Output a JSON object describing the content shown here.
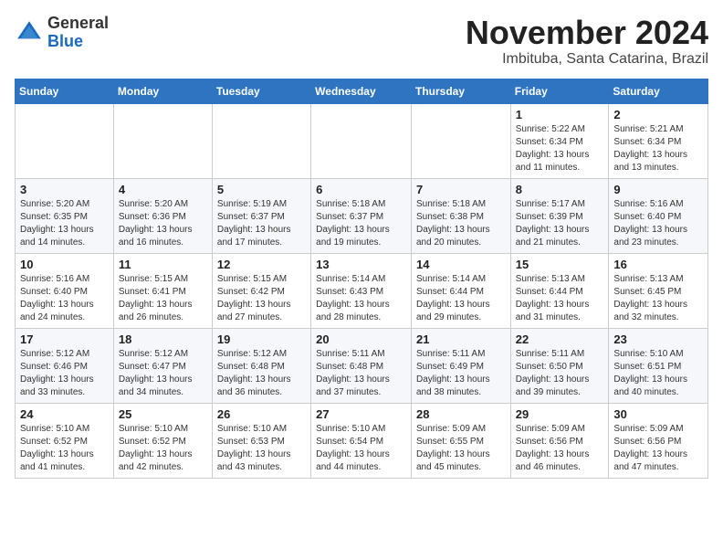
{
  "header": {
    "logo_general": "General",
    "logo_blue": "Blue",
    "month_title": "November 2024",
    "location": "Imbituba, Santa Catarina, Brazil"
  },
  "weekdays": [
    "Sunday",
    "Monday",
    "Tuesday",
    "Wednesday",
    "Thursday",
    "Friday",
    "Saturday"
  ],
  "weeks": [
    [
      {
        "day": "",
        "info": ""
      },
      {
        "day": "",
        "info": ""
      },
      {
        "day": "",
        "info": ""
      },
      {
        "day": "",
        "info": ""
      },
      {
        "day": "",
        "info": ""
      },
      {
        "day": "1",
        "info": "Sunrise: 5:22 AM\nSunset: 6:34 PM\nDaylight: 13 hours and 11 minutes."
      },
      {
        "day": "2",
        "info": "Sunrise: 5:21 AM\nSunset: 6:34 PM\nDaylight: 13 hours and 13 minutes."
      }
    ],
    [
      {
        "day": "3",
        "info": "Sunrise: 5:20 AM\nSunset: 6:35 PM\nDaylight: 13 hours and 14 minutes."
      },
      {
        "day": "4",
        "info": "Sunrise: 5:20 AM\nSunset: 6:36 PM\nDaylight: 13 hours and 16 minutes."
      },
      {
        "day": "5",
        "info": "Sunrise: 5:19 AM\nSunset: 6:37 PM\nDaylight: 13 hours and 17 minutes."
      },
      {
        "day": "6",
        "info": "Sunrise: 5:18 AM\nSunset: 6:37 PM\nDaylight: 13 hours and 19 minutes."
      },
      {
        "day": "7",
        "info": "Sunrise: 5:18 AM\nSunset: 6:38 PM\nDaylight: 13 hours and 20 minutes."
      },
      {
        "day": "8",
        "info": "Sunrise: 5:17 AM\nSunset: 6:39 PM\nDaylight: 13 hours and 21 minutes."
      },
      {
        "day": "9",
        "info": "Sunrise: 5:16 AM\nSunset: 6:40 PM\nDaylight: 13 hours and 23 minutes."
      }
    ],
    [
      {
        "day": "10",
        "info": "Sunrise: 5:16 AM\nSunset: 6:40 PM\nDaylight: 13 hours and 24 minutes."
      },
      {
        "day": "11",
        "info": "Sunrise: 5:15 AM\nSunset: 6:41 PM\nDaylight: 13 hours and 26 minutes."
      },
      {
        "day": "12",
        "info": "Sunrise: 5:15 AM\nSunset: 6:42 PM\nDaylight: 13 hours and 27 minutes."
      },
      {
        "day": "13",
        "info": "Sunrise: 5:14 AM\nSunset: 6:43 PM\nDaylight: 13 hours and 28 minutes."
      },
      {
        "day": "14",
        "info": "Sunrise: 5:14 AM\nSunset: 6:44 PM\nDaylight: 13 hours and 29 minutes."
      },
      {
        "day": "15",
        "info": "Sunrise: 5:13 AM\nSunset: 6:44 PM\nDaylight: 13 hours and 31 minutes."
      },
      {
        "day": "16",
        "info": "Sunrise: 5:13 AM\nSunset: 6:45 PM\nDaylight: 13 hours and 32 minutes."
      }
    ],
    [
      {
        "day": "17",
        "info": "Sunrise: 5:12 AM\nSunset: 6:46 PM\nDaylight: 13 hours and 33 minutes."
      },
      {
        "day": "18",
        "info": "Sunrise: 5:12 AM\nSunset: 6:47 PM\nDaylight: 13 hours and 34 minutes."
      },
      {
        "day": "19",
        "info": "Sunrise: 5:12 AM\nSunset: 6:48 PM\nDaylight: 13 hours and 36 minutes."
      },
      {
        "day": "20",
        "info": "Sunrise: 5:11 AM\nSunset: 6:48 PM\nDaylight: 13 hours and 37 minutes."
      },
      {
        "day": "21",
        "info": "Sunrise: 5:11 AM\nSunset: 6:49 PM\nDaylight: 13 hours and 38 minutes."
      },
      {
        "day": "22",
        "info": "Sunrise: 5:11 AM\nSunset: 6:50 PM\nDaylight: 13 hours and 39 minutes."
      },
      {
        "day": "23",
        "info": "Sunrise: 5:10 AM\nSunset: 6:51 PM\nDaylight: 13 hours and 40 minutes."
      }
    ],
    [
      {
        "day": "24",
        "info": "Sunrise: 5:10 AM\nSunset: 6:52 PM\nDaylight: 13 hours and 41 minutes."
      },
      {
        "day": "25",
        "info": "Sunrise: 5:10 AM\nSunset: 6:52 PM\nDaylight: 13 hours and 42 minutes."
      },
      {
        "day": "26",
        "info": "Sunrise: 5:10 AM\nSunset: 6:53 PM\nDaylight: 13 hours and 43 minutes."
      },
      {
        "day": "27",
        "info": "Sunrise: 5:10 AM\nSunset: 6:54 PM\nDaylight: 13 hours and 44 minutes."
      },
      {
        "day": "28",
        "info": "Sunrise: 5:09 AM\nSunset: 6:55 PM\nDaylight: 13 hours and 45 minutes."
      },
      {
        "day": "29",
        "info": "Sunrise: 5:09 AM\nSunset: 6:56 PM\nDaylight: 13 hours and 46 minutes."
      },
      {
        "day": "30",
        "info": "Sunrise: 5:09 AM\nSunset: 6:56 PM\nDaylight: 13 hours and 47 minutes."
      }
    ]
  ]
}
